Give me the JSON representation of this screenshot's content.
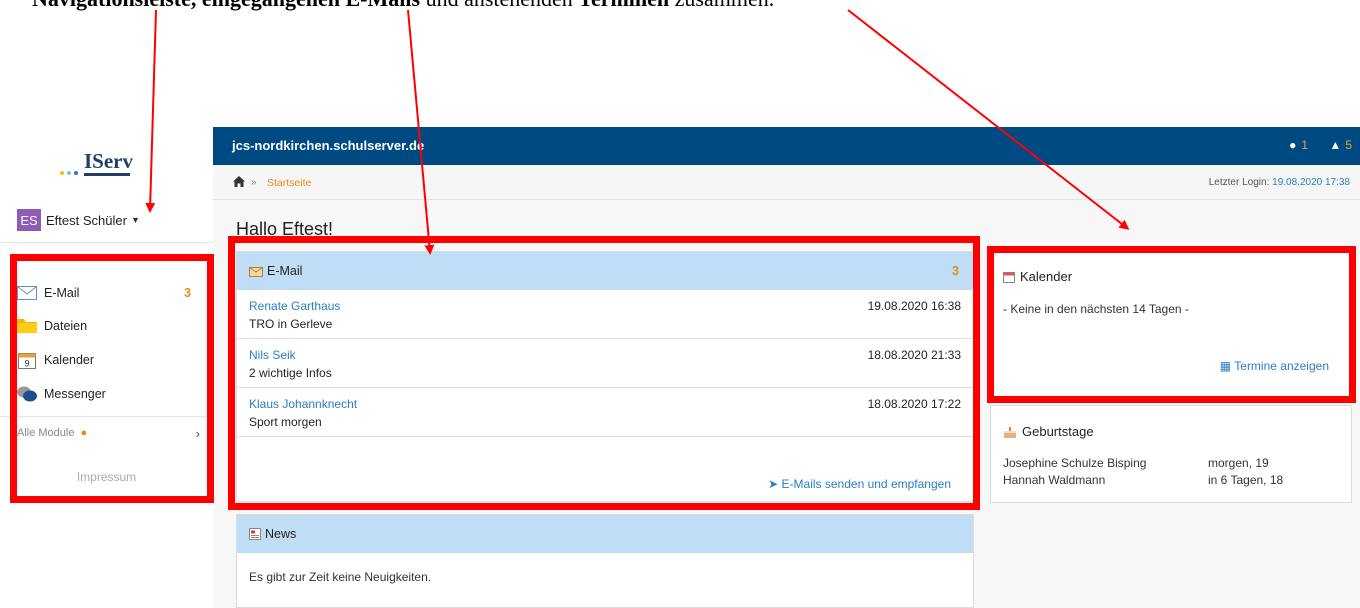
{
  "caption": {
    "prefix": "Navigationsleiste,",
    "bold_mid": "eingegangenen E-Mails",
    "mid": "und anstehenden",
    "bold_end": "Terminen",
    "suffix": "zusammen."
  },
  "brand": {
    "name": "IServ",
    "accent": "#004a83"
  },
  "user": {
    "initials": "ES",
    "name": "Eftest Schüler"
  },
  "sidebar": {
    "items": [
      {
        "label": "E-Mail",
        "icon": "mail-icon",
        "count": "3"
      },
      {
        "label": "Dateien",
        "icon": "folder-icon",
        "count": ""
      },
      {
        "label": "Kalender",
        "icon": "calendar-icon",
        "count": ""
      },
      {
        "label": "Messenger",
        "icon": "chat-icon",
        "count": ""
      }
    ],
    "all_modules": "Alle Module",
    "impressum": "Impressum"
  },
  "topbar": {
    "title": "jcs-nordkirchen.schulserver.de",
    "info_count": "1",
    "notif_count": "5"
  },
  "breadcrumb": {
    "separator": "»",
    "current": "Startseite",
    "last_login_label": "Letzter Login:",
    "last_login_value": "19.08.2020 17:38"
  },
  "greeting": "Hallo Eftest!",
  "email_panel": {
    "title": "E-Mail",
    "count": "3",
    "mails": [
      {
        "from": "Renate Garthaus",
        "subject": "TRO in Gerleve",
        "date": "19.08.2020 16:38"
      },
      {
        "from": "Nils Seik",
        "subject": "2 wichtige Infos",
        "date": "18.08.2020 21:33"
      },
      {
        "from": "Klaus Johannknecht",
        "subject": "Sport morgen",
        "date": "18.08.2020 17:22"
      }
    ],
    "action": "E-Mails senden und empfangen"
  },
  "news_panel": {
    "title": "News",
    "text": "Es gibt zur Zeit keine Neuigkeiten."
  },
  "calendar_panel": {
    "title": "Kalender",
    "text": "- Keine in den nächsten 14 Tagen -",
    "action": "Termine anzeigen"
  },
  "birthday_panel": {
    "title": "Geburtstage",
    "rows": [
      {
        "name": "Josephine Schulze Bisping",
        "when": "morgen, 19"
      },
      {
        "name": "Hannah Waldmann",
        "when": "in 6 Tagen, 18"
      }
    ]
  }
}
